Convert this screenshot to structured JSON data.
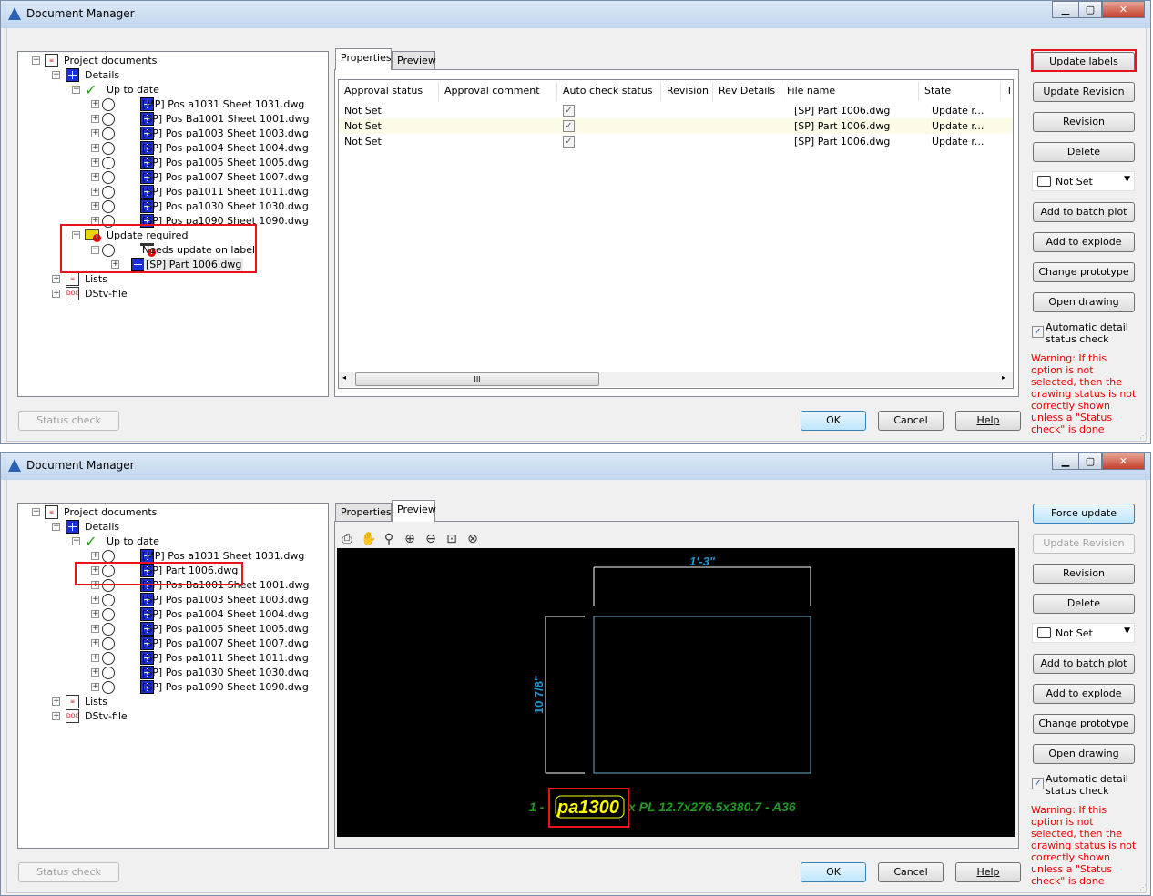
{
  "windows": [
    {
      "title": "Document Manager",
      "controls": {
        "minimize": "▁",
        "maximize": "▢",
        "close": "✕"
      },
      "tree": [
        {
          "label": "Project documents",
          "level": 0,
          "icon": "documents-icon",
          "exp": "−"
        },
        {
          "label": "Details",
          "level": 1,
          "icon": "drawing-icon",
          "exp": "−"
        },
        {
          "label": "Up to date",
          "level": 2,
          "icon": "checkmark-icon",
          "exp": "−"
        },
        {
          "label": "[MP] Pos a1031 Sheet 1031.dwg",
          "level": 3,
          "icon": "drawing-icon",
          "exp": "+"
        },
        {
          "label": "[SP] Pos Ba1001 Sheet 1001.dwg",
          "level": 3,
          "icon": "drawing-icon",
          "exp": "+"
        },
        {
          "label": "[SP] Pos pa1003 Sheet 1003.dwg",
          "level": 3,
          "icon": "drawing-icon",
          "exp": "+"
        },
        {
          "label": "[SP] Pos pa1004 Sheet 1004.dwg",
          "level": 3,
          "icon": "drawing-icon",
          "exp": "+"
        },
        {
          "label": "[SP] Pos pa1005 Sheet 1005.dwg",
          "level": 3,
          "icon": "drawing-icon",
          "exp": "+"
        },
        {
          "label": "[SP] Pos pa1007 Sheet 1007.dwg",
          "level": 3,
          "icon": "drawing-icon",
          "exp": "+"
        },
        {
          "label": "[SP] Pos pa1011 Sheet 1011.dwg",
          "level": 3,
          "icon": "drawing-icon",
          "exp": "+"
        },
        {
          "label": "[SP] Pos pa1030 Sheet 1030.dwg",
          "level": 3,
          "icon": "drawing-icon",
          "exp": "+"
        },
        {
          "label": "[SP] Pos pa1090 Sheet 1090.dwg",
          "level": 3,
          "icon": "drawing-icon",
          "exp": "+"
        },
        {
          "label": "Update required",
          "level": 2,
          "icon": "update-required-icon",
          "exp": "−"
        },
        {
          "label": "Needs update on label",
          "level": 3,
          "icon": "label-update-icon",
          "exp": "−"
        },
        {
          "label": "[SP] Part 1006.dwg",
          "level": 4,
          "icon": "drawing-icon",
          "exp": "+",
          "selected": true
        },
        {
          "label": "Lists",
          "level": 1,
          "icon": "lists-icon",
          "exp": "+"
        },
        {
          "label": "DStv-file",
          "level": 1,
          "icon": "dstv-icon",
          "exp": "+"
        }
      ],
      "tabs": [
        "Properties",
        "Preview"
      ],
      "active_tab": "Properties",
      "table": {
        "columns": [
          "Approval status",
          "Approval comment",
          "Auto check status",
          "Revision",
          "Rev Details",
          "File name",
          "State",
          "T"
        ],
        "rows": [
          {
            "approval_status": "Not Set",
            "approval_comment": "",
            "auto_check": true,
            "revision": "",
            "rev_details": "",
            "file_name": "[SP] Part 1006.dwg",
            "state": "Update r..."
          },
          {
            "approval_status": "Not Set",
            "approval_comment": "",
            "auto_check": true,
            "revision": "",
            "rev_details": "",
            "file_name": "[SP] Part 1006.dwg",
            "state": "Update r..."
          },
          {
            "approval_status": "Not Set",
            "approval_comment": "",
            "auto_check": true,
            "revision": "",
            "rev_details": "",
            "file_name": "[SP] Part 1006.dwg",
            "state": "Update r..."
          }
        ]
      },
      "side_buttons": [
        {
          "label": "Update labels",
          "state": "normal",
          "highlighted": true
        },
        {
          "label": "Update Revision",
          "state": "normal"
        },
        {
          "label": "Revision",
          "state": "normal"
        },
        {
          "label": "Delete",
          "state": "normal"
        }
      ],
      "status_select": "Not Set",
      "side_buttons2": [
        "Add to batch plot",
        "Add to explode",
        "Change prototype",
        "Open drawing"
      ],
      "auto_check_label": "Automatic detail status check",
      "auto_check_checked": true,
      "warning": "Warning: If this option is not selected, then the drawing status is not correctly shown unless a \"Status check\" is done",
      "status_check": "Status check",
      "ok": "OK",
      "cancel": "Cancel",
      "help": "Help"
    },
    {
      "title": "Document Manager",
      "controls": {
        "minimize": "▁",
        "maximize": "▢",
        "close": "✕"
      },
      "tree": [
        {
          "label": "Project documents",
          "level": 0,
          "icon": "documents-icon",
          "exp": "−"
        },
        {
          "label": "Details",
          "level": 1,
          "icon": "drawing-icon",
          "exp": "−"
        },
        {
          "label": "Up to date",
          "level": 2,
          "icon": "checkmark-icon",
          "exp": "−"
        },
        {
          "label": "[MP] Pos a1031 Sheet 1031.dwg",
          "level": 3,
          "icon": "drawing-icon",
          "exp": "+"
        },
        {
          "label": "[SP] Part 1006.dwg",
          "level": 3,
          "icon": "drawing-icon",
          "exp": "+",
          "highlighted": true
        },
        {
          "label": "[SP] Pos Ba1001 Sheet 1001.dwg",
          "level": 3,
          "icon": "drawing-icon",
          "exp": "+"
        },
        {
          "label": "[SP] Pos pa1003 Sheet 1003.dwg",
          "level": 3,
          "icon": "drawing-icon",
          "exp": "+"
        },
        {
          "label": "[SP] Pos pa1004 Sheet 1004.dwg",
          "level": 3,
          "icon": "drawing-icon",
          "exp": "+"
        },
        {
          "label": "[SP] Pos pa1005 Sheet 1005.dwg",
          "level": 3,
          "icon": "drawing-icon",
          "exp": "+"
        },
        {
          "label": "[SP] Pos pa1007 Sheet 1007.dwg",
          "level": 3,
          "icon": "drawing-icon",
          "exp": "+"
        },
        {
          "label": "[SP] Pos pa1011 Sheet 1011.dwg",
          "level": 3,
          "icon": "drawing-icon",
          "exp": "+"
        },
        {
          "label": "[SP] Pos pa1030 Sheet 1030.dwg",
          "level": 3,
          "icon": "drawing-icon",
          "exp": "+"
        },
        {
          "label": "[SP] Pos pa1090 Sheet 1090.dwg",
          "level": 3,
          "icon": "drawing-icon",
          "exp": "+"
        },
        {
          "label": "Lists",
          "level": 1,
          "icon": "lists-icon",
          "exp": "+"
        },
        {
          "label": "DStv-file",
          "level": 1,
          "icon": "dstv-icon",
          "exp": "+"
        }
      ],
      "tabs": [
        "Properties",
        "Preview"
      ],
      "active_tab": "Preview",
      "preview": {
        "toolbar": [
          "print-icon",
          "pan-icon",
          "zoom-realtime-icon",
          "zoom-in-icon",
          "zoom-out-icon",
          "zoom-window-icon",
          "zoom-extents-icon"
        ],
        "width_dimension": "1'-3\"",
        "height_dimension": "10 7/8\"",
        "label_prefix": "1 -",
        "label_position": "pa1300",
        "label_suffix": "x PL 12.7x276.5x380.7 - A36",
        "colors": {
          "dimension": "#1a9ad6",
          "label": "#1f9a1f",
          "position": "#ffff00",
          "outline": "#6fa8c8"
        }
      },
      "side_buttons": [
        {
          "label": "Force update",
          "state": "focused"
        },
        {
          "label": "Update Revision",
          "state": "disabled"
        },
        {
          "label": "Revision",
          "state": "normal"
        },
        {
          "label": "Delete",
          "state": "normal"
        }
      ],
      "status_select": "Not Set",
      "side_buttons2": [
        "Add to batch plot",
        "Add to explode",
        "Change prototype",
        "Open drawing"
      ],
      "auto_check_label": "Automatic detail status check",
      "auto_check_checked": true,
      "warning": "Warning: If this option is not selected, then the drawing status is not correctly shown unless a \"Status check\" is done",
      "status_check": "Status check",
      "ok": "OK",
      "cancel": "Cancel",
      "help": "Help"
    }
  ],
  "highlight_color": "#e8131b"
}
